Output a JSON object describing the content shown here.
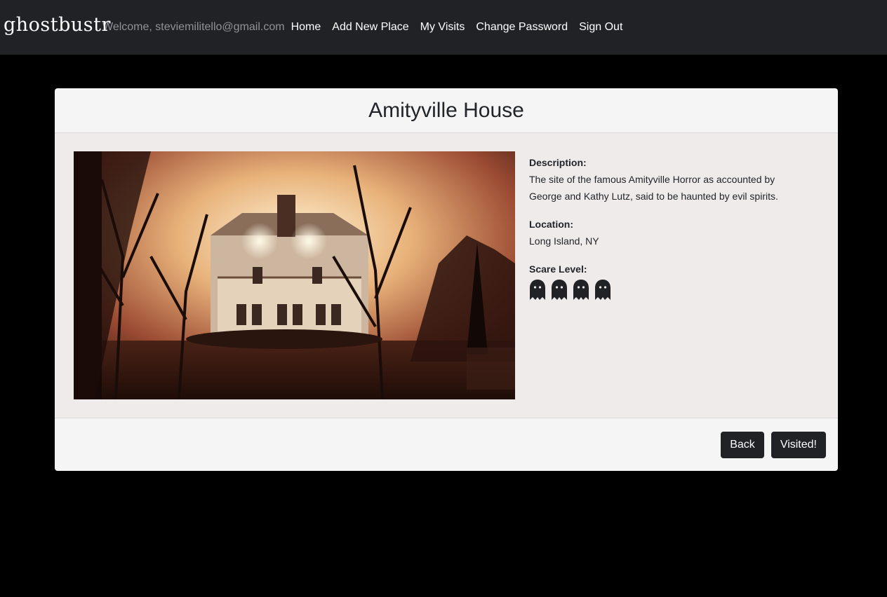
{
  "navbar": {
    "brand": "ghostbustr",
    "welcome": "Welcome, steviemilitello@gmail.com",
    "links": [
      "Home",
      "Add New Place",
      "My Visits",
      "Change Password",
      "Sign Out"
    ]
  },
  "place": {
    "title": "Amityville House",
    "description_label": "Description:",
    "description": "The site of the famous Amityville Horror as accounted by George and Kathy Lutz, said to be haunted by evil spirits.",
    "location_label": "Location:",
    "location": "Long Island, NY",
    "scare_label": "Scare Level:",
    "scare_level": 4,
    "scare_icon": "ghost-icon"
  },
  "footer": {
    "back_label": "Back",
    "visited_label": "Visited!"
  },
  "colors": {
    "navbar_bg": "#212226",
    "page_bg": "#000000",
    "card_bg": "#f5f5f5",
    "body_bg": "#f0ebeb",
    "button_bg": "#212226"
  }
}
